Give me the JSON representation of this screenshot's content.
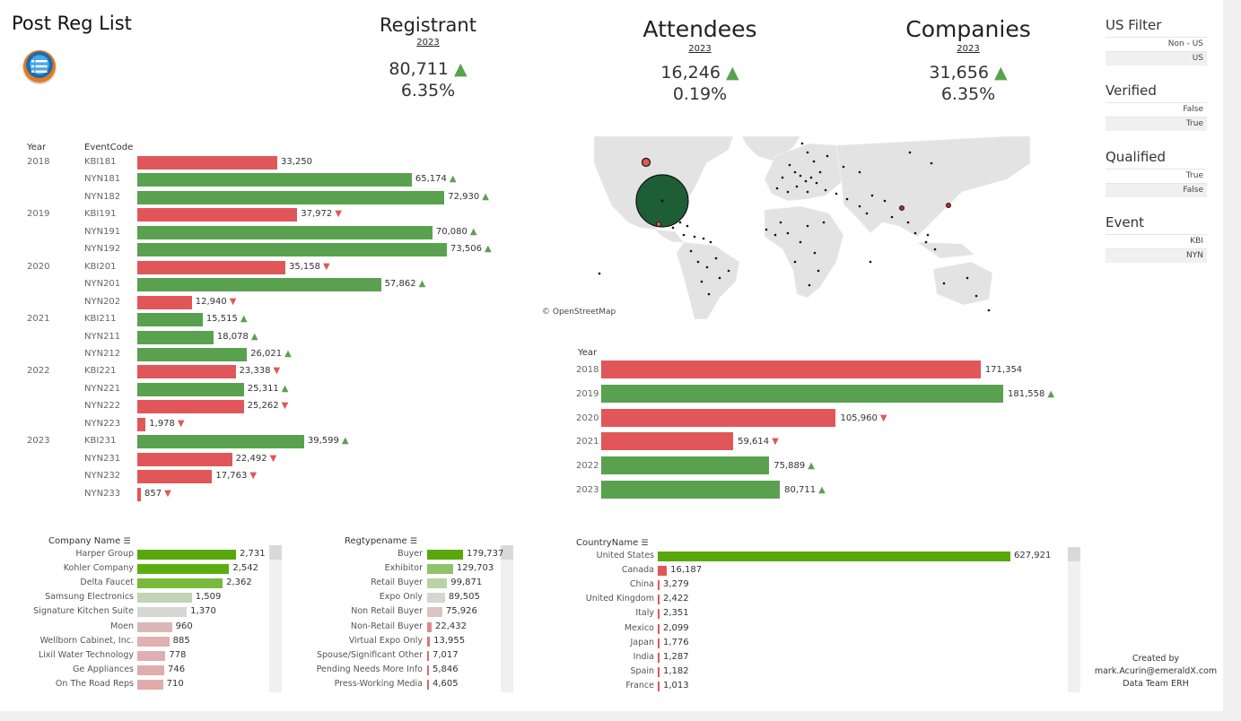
{
  "title": "Post Reg List",
  "kpis": [
    {
      "name": "registrant",
      "title": "Registrant",
      "year": "2023",
      "value": "80,711",
      "pct": "6.35%",
      "trend": "up"
    },
    {
      "name": "attendees",
      "title": "Attendees",
      "year": "2023",
      "value": "16,246",
      "pct": "0.19%",
      "trend": "up"
    },
    {
      "name": "companies",
      "title": "Companies",
      "year": "2023",
      "value": "31,656",
      "pct": "6.35%",
      "trend": "up"
    }
  ],
  "filters": [
    {
      "name": "us-filter",
      "title": "US Filter",
      "options": [
        "Non - US",
        "US"
      ]
    },
    {
      "name": "verified",
      "title": "Verified",
      "options": [
        "False",
        "True"
      ]
    },
    {
      "name": "qualified",
      "title": "Qualified",
      "options": [
        "True",
        "False"
      ]
    },
    {
      "name": "event",
      "title": "Event",
      "options": [
        "KBI",
        "NYN"
      ]
    }
  ],
  "colors": {
    "green": "#59a14f",
    "red": "#e15759",
    "bright_green": "#58a80c"
  },
  "map": {
    "attribution": "© OpenStreetMap"
  },
  "credit": {
    "line1": "Created by",
    "line2": "mark.Acurin@emeraldX.com",
    "line3": "Data Team ERH"
  },
  "chart_data": [
    {
      "name": "event-bars",
      "type": "bar",
      "orientation": "horizontal",
      "headers": {
        "year": "Year",
        "event": "EventCode"
      },
      "rows": [
        {
          "year": "2018",
          "code": "KBI181",
          "value": 33250,
          "label": "33,250",
          "color": "red",
          "trend": ""
        },
        {
          "year": "",
          "code": "NYN181",
          "value": 65174,
          "label": "65,174",
          "color": "green",
          "trend": "up"
        },
        {
          "year": "",
          "code": "NYN182",
          "value": 72930,
          "label": "72,930",
          "color": "green",
          "trend": "up"
        },
        {
          "year": "2019",
          "code": "KBI191",
          "value": 37972,
          "label": "37,972",
          "color": "red",
          "trend": "down"
        },
        {
          "year": "",
          "code": "NYN191",
          "value": 70080,
          "label": "70,080",
          "color": "green",
          "trend": "up"
        },
        {
          "year": "",
          "code": "NYN192",
          "value": 73506,
          "label": "73,506",
          "color": "green",
          "trend": "up"
        },
        {
          "year": "2020",
          "code": "KBI201",
          "value": 35158,
          "label": "35,158",
          "color": "red",
          "trend": "down"
        },
        {
          "year": "",
          "code": "NYN201",
          "value": 57862,
          "label": "57,862",
          "color": "green",
          "trend": "up"
        },
        {
          "year": "",
          "code": "NYN202",
          "value": 12940,
          "label": "12,940",
          "color": "red",
          "trend": "down"
        },
        {
          "year": "2021",
          "code": "KBI211",
          "value": 15515,
          "label": "15,515",
          "color": "green",
          "trend": "up"
        },
        {
          "year": "",
          "code": "NYN211",
          "value": 18078,
          "label": "18,078",
          "color": "green",
          "trend": "up"
        },
        {
          "year": "",
          "code": "NYN212",
          "value": 26021,
          "label": "26,021",
          "color": "green",
          "trend": "up"
        },
        {
          "year": "2022",
          "code": "KBI221",
          "value": 23338,
          "label": "23,338",
          "color": "red",
          "trend": "down"
        },
        {
          "year": "",
          "code": "NYN221",
          "value": 25311,
          "label": "25,311",
          "color": "green",
          "trend": "up"
        },
        {
          "year": "",
          "code": "NYN222",
          "value": 25262,
          "label": "25,262",
          "color": "red",
          "trend": "down"
        },
        {
          "year": "",
          "code": "NYN223",
          "value": 1978,
          "label": "1,978",
          "color": "red",
          "trend": "down"
        },
        {
          "year": "2023",
          "code": "KBI231",
          "value": 39599,
          "label": "39,599",
          "color": "green",
          "trend": "up"
        },
        {
          "year": "",
          "code": "NYN231",
          "value": 22492,
          "label": "22,492",
          "color": "red",
          "trend": "down"
        },
        {
          "year": "",
          "code": "NYN232",
          "value": 17763,
          "label": "17,763",
          "color": "red",
          "trend": "down"
        },
        {
          "year": "",
          "code": "NYN233",
          "value": 857,
          "label": "857",
          "color": "red",
          "trend": "down"
        }
      ]
    },
    {
      "name": "year-bars",
      "type": "bar",
      "orientation": "horizontal",
      "headers": {
        "year": "Year"
      },
      "rows": [
        {
          "year": "2018",
          "value": 171354,
          "label": "171,354",
          "color": "red",
          "trend": ""
        },
        {
          "year": "2019",
          "value": 181558,
          "label": "181,558",
          "color": "green",
          "trend": "up"
        },
        {
          "year": "2020",
          "value": 105960,
          "label": "105,960",
          "color": "red",
          "trend": "down"
        },
        {
          "year": "2021",
          "value": 59614,
          "label": "59,614",
          "color": "red",
          "trend": "down"
        },
        {
          "year": "2022",
          "value": 75889,
          "label": "75,889",
          "color": "green",
          "trend": "up"
        },
        {
          "year": "2023",
          "value": 80711,
          "label": "80,711",
          "color": "green",
          "trend": "up"
        }
      ]
    },
    {
      "name": "company-bars",
      "type": "bar",
      "orientation": "horizontal",
      "header": "Company Name",
      "rows": [
        {
          "label": "Harper Group",
          "value": 2731,
          "text": "2,731",
          "color": "#58a80c"
        },
        {
          "label": "Kohler Company",
          "value": 2542,
          "text": "2,542",
          "color": "#5dab12"
        },
        {
          "label": "Delta Faucet",
          "value": 2362,
          "text": "2,362",
          "color": "#79b93c"
        },
        {
          "label": "Samsung Electronics",
          "value": 1509,
          "text": "1,509",
          "color": "#c2d4b3"
        },
        {
          "label": "Signature Kitchen Suite",
          "value": 1370,
          "text": "1,370",
          "color": "#d6d6d2"
        },
        {
          "label": "Moen",
          "value": 960,
          "text": "960",
          "color": "#dcb7b7"
        },
        {
          "label": "Wellborn Cabinet, Inc.",
          "value": 885,
          "text": "885",
          "color": "#dfb1b1"
        },
        {
          "label": "Lixil Water Technology",
          "value": 778,
          "text": "778",
          "color": "#e0aeae"
        },
        {
          "label": "Ge Appliances",
          "value": 746,
          "text": "746",
          "color": "#e0adad"
        },
        {
          "label": "On The Road Reps",
          "value": 710,
          "text": "710",
          "color": "#e1abab"
        }
      ]
    },
    {
      "name": "regtype-bars",
      "type": "bar",
      "orientation": "horizontal",
      "header": "Regtypename",
      "rows": [
        {
          "label": "Buyer",
          "value": 179737,
          "text": "179,737",
          "color": "#58a80c"
        },
        {
          "label": "Exhibitor",
          "value": 129703,
          "text": "129,703",
          "color": "#8fc26b"
        },
        {
          "label": "Retail Buyer",
          "value": 99871,
          "text": "99,871",
          "color": "#b9d3a4"
        },
        {
          "label": "Expo Only",
          "value": 89505,
          "text": "89,505",
          "color": "#d4d6d2"
        },
        {
          "label": "Non Retail Buyer",
          "value": 75926,
          "text": "75,926",
          "color": "#dcc3c3"
        },
        {
          "label": "Non-Retail Buyer",
          "value": 22432,
          "text": "22,432",
          "color": "#e08a8a"
        },
        {
          "label": "Virtual Expo Only",
          "value": 13955,
          "text": "13,955",
          "color": "#e07575"
        },
        {
          "label": "Spouse/Significant Other",
          "value": 7017,
          "text": "7,017",
          "color": "#e06c6c"
        },
        {
          "label": "Pending Needs More Info",
          "value": 5846,
          "text": "5,846",
          "color": "#e06a6a"
        },
        {
          "label": "Press-Working Media",
          "value": 4605,
          "text": "4,605",
          "color": "#e06868"
        }
      ]
    },
    {
      "name": "country-bars",
      "type": "bar",
      "orientation": "horizontal",
      "header": "CountryName",
      "rows": [
        {
          "label": "United States",
          "value": 627921,
          "text": "627,921",
          "color": "#58a80c"
        },
        {
          "label": "Canada",
          "value": 16187,
          "text": "16,187",
          "color": "#e15759"
        },
        {
          "label": "China",
          "value": 3279,
          "text": "3,279",
          "color": "#e15759"
        },
        {
          "label": "United Kingdom",
          "value": 2422,
          "text": "2,422",
          "color": "#e15759"
        },
        {
          "label": "Italy",
          "value": 2351,
          "text": "2,351",
          "color": "#e15759"
        },
        {
          "label": "Mexico",
          "value": 2099,
          "text": "2,099",
          "color": "#e15759"
        },
        {
          "label": "Japan",
          "value": 1776,
          "text": "1,776",
          "color": "#e15759"
        },
        {
          "label": "India",
          "value": 1287,
          "text": "1,287",
          "color": "#e15759"
        },
        {
          "label": "Spain",
          "value": 1182,
          "text": "1,182",
          "color": "#e15759"
        },
        {
          "label": "France",
          "value": 1013,
          "text": "1,013",
          "color": "#e15759"
        }
      ]
    }
  ]
}
